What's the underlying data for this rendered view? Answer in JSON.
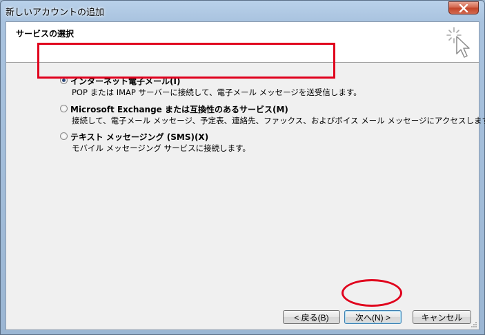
{
  "window": {
    "title": "新しいアカウントの追加"
  },
  "header": {
    "title": "サービスの選択"
  },
  "options": [
    {
      "label": "インターネット電子メール(I)",
      "description": "POP または IMAP サーバーに接続して、電子メール メッセージを送受信します。",
      "selected": true
    },
    {
      "label": "Microsoft Exchange または互換性のあるサービス(M)",
      "description": "接続して、電子メール メッセージ、予定表、連絡先、ファックス、およびボイス メール メッセージにアクセスします。",
      "selected": false
    },
    {
      "label": "テキスト メッセージング (SMS)(X)",
      "description": "モバイル メッセージング サービスに接続します。",
      "selected": false
    }
  ],
  "buttons": {
    "back": "< 戻る(B)",
    "next": "次へ(N) >",
    "cancel": "キャンセル"
  },
  "icons": {
    "close": "close-icon",
    "wizard": "cursor-sparkle-icon"
  },
  "colors": {
    "annotation": "#e0001c",
    "accent": "#3c7fb1"
  }
}
